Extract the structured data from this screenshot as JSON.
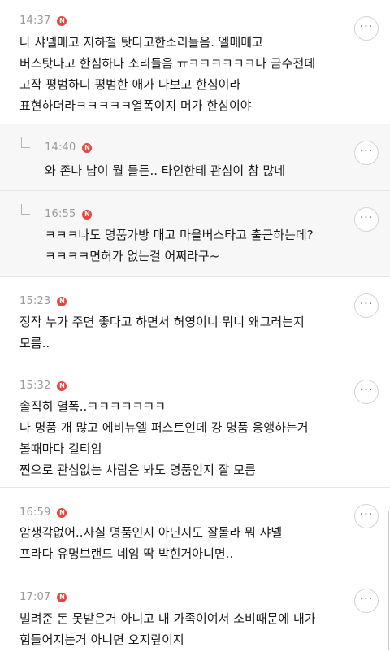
{
  "comments": [
    {
      "time": "14:37",
      "badge": "N",
      "more": "···",
      "text": "나 샤넬매고 지하철 탓다고한소리들음. 엘매메고\n버스탓다고 한심하다 소리들음 ㅠㅋㅋㅋㅋㅋㅋ나 금수전데\n고작 평범하디 평범한 애가 나보고 한심이라\n표현하더라ㅋㅋㅋㅋㅋ열폭이지 머가 한심이야"
    },
    {
      "time": "14:40",
      "badge": "N",
      "more": "···",
      "text": "와 존나 남이 뭘 들든.. 타인한테 관심이 참 많네"
    },
    {
      "time": "16:55",
      "badge": "N",
      "more": "···",
      "text": "ㅋㅋㅋ나도 명품가방 매고 마을버스타고 출근하는데?\nㅋㅋㅋㅋ면허가 없는걸 어쩌라구~"
    },
    {
      "time": "15:23",
      "badge": "N",
      "more": "···",
      "text": "정작 누가 주면 좋다고 하면서 허영이니 뭐니 왜그러는지\n모름.."
    },
    {
      "time": "15:32",
      "badge": "N",
      "more": "···",
      "text": "솔직히 열폭..ㅋㅋㅋㅋㅋㅋㅋ\n나 명품 개 많고 에비뉴엘 퍼스트인데 걍 명품 웅앵하는거\n볼때마다 길티임\n찐으로 관심없는 사람은 봐도 명품인지 잘 모름"
    },
    {
      "time": "16:59",
      "badge": "N",
      "more": "···",
      "text": "암생각없어..사실 명품인지 아닌지도 잘몰라 뭐 샤넬\n프라다 유명브랜드 네임 딱 박힌거아니면.."
    },
    {
      "time": "17:07",
      "badge": "N",
      "more": "···",
      "text": "빌려준 돈 못받은거 아니고 내 가족이여서 소비때문에 내가\n힘들어지는거 아니면 오지랖이지"
    }
  ]
}
